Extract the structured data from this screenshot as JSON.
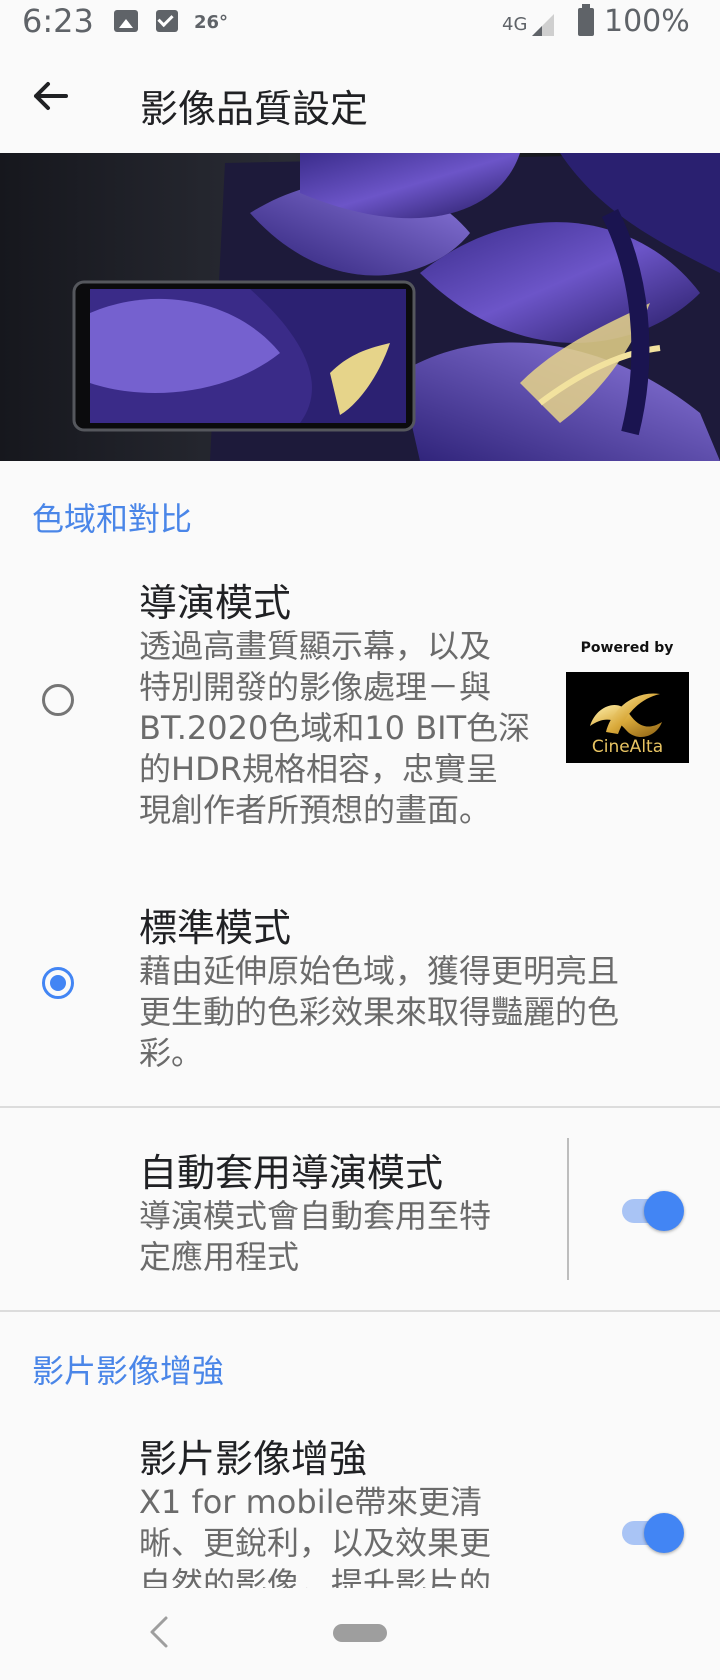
{
  "status_bar": {
    "time": "6:23",
    "temperature": "26°",
    "network": "4G",
    "battery": "100%",
    "icons": [
      "image-icon",
      "checkbox-icon",
      "signal-icon",
      "battery-icon"
    ]
  },
  "app_bar": {
    "back_icon": "arrow-left-icon",
    "title": "影像品質設定"
  },
  "sections": {
    "color_contrast": {
      "header": "色域和對比",
      "director_mode": {
        "title": "導演模式",
        "description": "透過高畫質顯示幕，以及特別開發的影像處理－與BT.2020色域和10 BIT色深的HDR規格相容，忠實呈現創作者所預想的畫面。",
        "desc_lines": [
          "透過高畫質顯示幕，以及",
          "特別開發的影像處理－與",
          "BT.2020色域和10 BIT色深",
          "的HDR規格相容，忠實呈",
          "現創作者所預想的畫面。"
        ],
        "selected": false,
        "badge": {
          "powered_by": "Powered by",
          "logo_text": "CineAlta"
        }
      },
      "standard_mode": {
        "title": "標準模式",
        "description": "藉由延伸原始色域，獲得更明亮且更生動的色彩效果來取得豔麗的色彩。",
        "desc_lines": [
          "藉由延伸原始色域，獲得更明亮且",
          "更生動的色彩效果來取得豔麗的色",
          "彩。"
        ],
        "selected": true
      },
      "auto_director": {
        "title": "自動套用導演模式",
        "description": "導演模式會自動套用至特定應用程式",
        "desc_lines": [
          "導演模式會自動套用至特",
          "定應用程式"
        ],
        "enabled": true
      }
    },
    "video_enhance": {
      "header": "影片影像增強",
      "item": {
        "title": "影片影像增強",
        "desc_lines": [
          "X1 for mobile帶來更清",
          "晰、更銳利，以及效果更",
          "自然的影像，提升影片的"
        ],
        "enabled": true
      }
    }
  },
  "nav_bar": {
    "back_icon": "nav-back-icon",
    "home_icon": "home-pill-icon"
  },
  "colors": {
    "accent": "#4285f4",
    "section_header": "#4a86e8",
    "switch_track": "#a9c4f5",
    "logo_gold": "#e8c463"
  }
}
